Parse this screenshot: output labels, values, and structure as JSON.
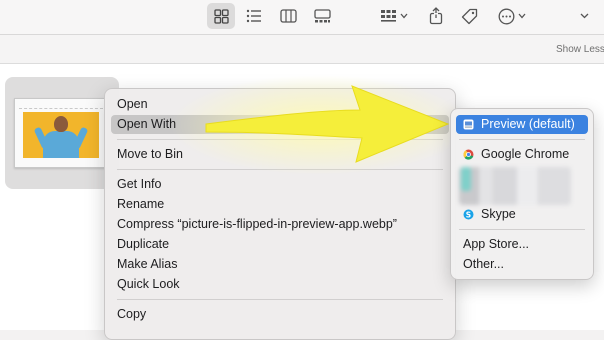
{
  "toolbar": {
    "buttons": [
      {
        "name": "icon-view-button",
        "icon": "grid-icon",
        "active": true
      },
      {
        "name": "list-view-button",
        "icon": "list-icon",
        "active": false
      },
      {
        "name": "column-view-button",
        "icon": "columns-icon",
        "active": false
      },
      {
        "name": "gallery-view-button",
        "icon": "gallery-icon",
        "active": false
      },
      {
        "name": "group-button",
        "icon": "group-grid-icon",
        "active": false
      },
      {
        "name": "share-button",
        "icon": "share-icon",
        "active": false
      },
      {
        "name": "tags-button",
        "icon": "tag-icon",
        "active": false
      },
      {
        "name": "action-button",
        "icon": "ellipsis-circle-icon",
        "active": false
      },
      {
        "name": "more-button",
        "icon": "chevron-down-icon",
        "active": false
      }
    ]
  },
  "subbar": {
    "show_less": "Show Less"
  },
  "file": {
    "thumbnail_colors": {
      "background": "#f2b52b",
      "shirt": "#5aa9d8",
      "skin": "#8a5a3c"
    }
  },
  "context_menu": {
    "open": "Open",
    "open_with": "Open With",
    "move_to_bin": "Move to Bin",
    "get_info": "Get Info",
    "rename": "Rename",
    "compress": "Compress “picture-is-flipped-in-preview-app.webp”",
    "duplicate": "Duplicate",
    "make_alias": "Make Alias",
    "quick_look": "Quick Look",
    "copy": "Copy"
  },
  "open_with_submenu": {
    "preview": "Preview (default)",
    "chrome": "Google Chrome",
    "skype": "Skype",
    "app_store": "App Store...",
    "other": "Other..."
  },
  "colors": {
    "selection": "#3b82e0",
    "highlight": "#c7c6c6",
    "arrow": "#f5ee3a"
  }
}
